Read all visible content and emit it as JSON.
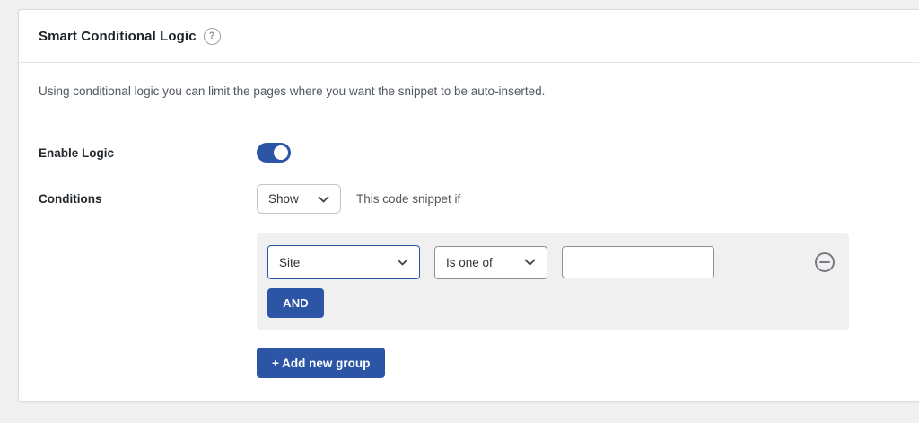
{
  "card": {
    "title": "Smart Conditional Logic",
    "help_glyph": "?",
    "description": "Using conditional logic you can limit the pages where you want the snippet to be auto-inserted.",
    "enable_logic": {
      "label": "Enable Logic",
      "enabled": true
    },
    "conditions": {
      "label": "Conditions",
      "action_value": "Show",
      "hint": "This code snippet if"
    },
    "group": {
      "field_value": "Site",
      "operator_value": "Is one of",
      "value_input": "",
      "and_label": "AND"
    },
    "add_group_label": "+ Add new group",
    "colors": {
      "accent_blue": "#2d55a5",
      "page_background": "#f0f0f1",
      "group_background": "#f0f0f1",
      "border_gray": "#8c8f94"
    }
  }
}
